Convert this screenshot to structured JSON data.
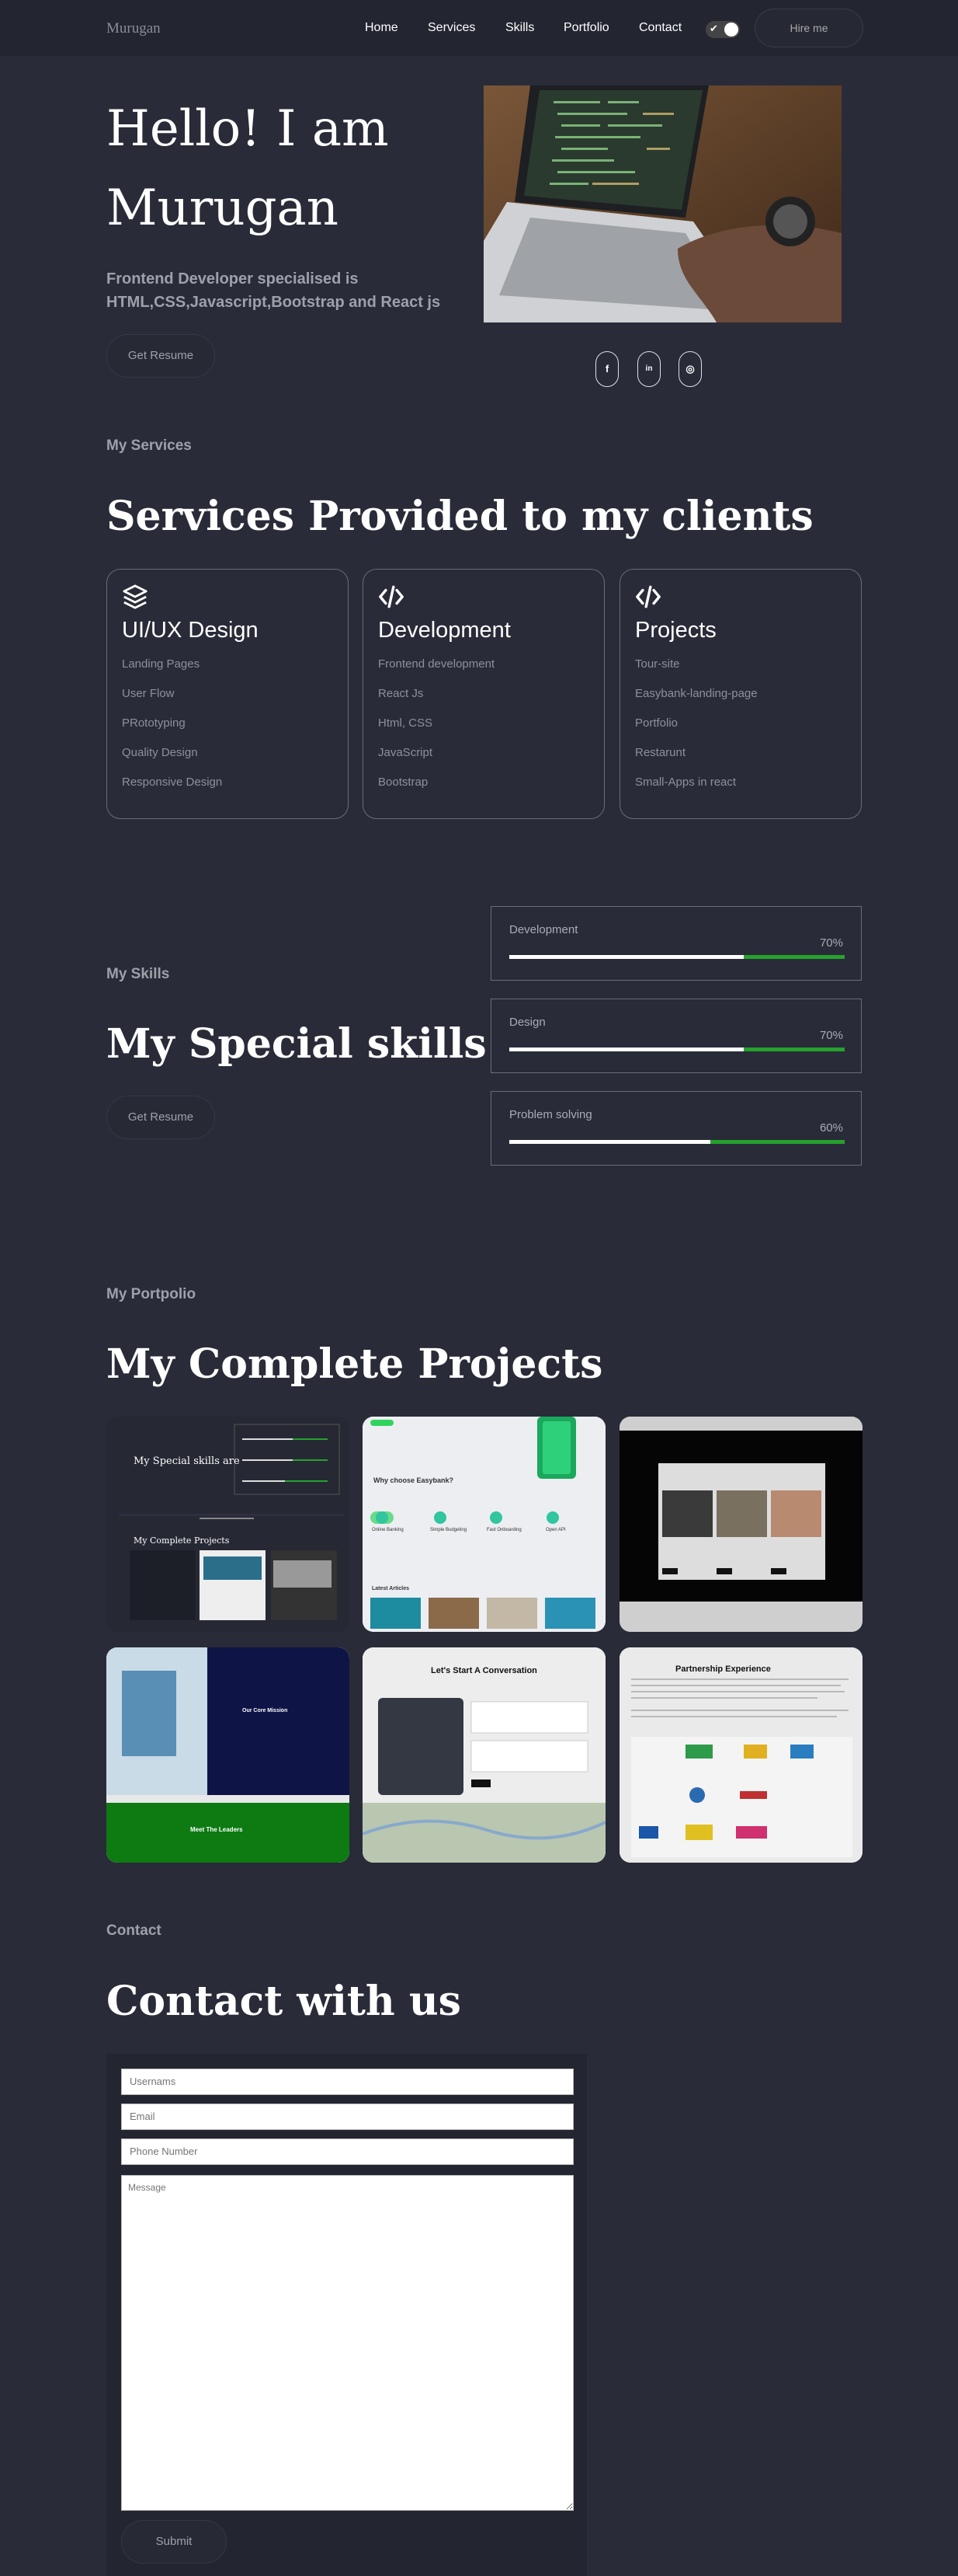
{
  "nav": {
    "logo": "Murugan",
    "links": [
      "Home",
      "Services",
      "Skills",
      "Portfolio",
      "Contact"
    ],
    "hire_label": "Hire me",
    "theme_toggle_check": "✔"
  },
  "hero": {
    "title": "Hello! I am Murugan",
    "subtitle": "Frontend Developer specialised is HTML,CSS,Javascript,Bootstrap and React js",
    "resume_label": "Get Resume",
    "socials": [
      {
        "icon": "facebook-icon",
        "glyph": "f"
      },
      {
        "icon": "linkedin-icon",
        "glyph": "in"
      },
      {
        "icon": "instagram-icon",
        "glyph": "◎"
      }
    ]
  },
  "services": {
    "label": "My Services",
    "heading": "Services Provided to my clients",
    "cards": [
      {
        "icon": "layers-icon",
        "title": "UI/UX Design",
        "items": [
          "Landing Pages",
          "User Flow",
          "PRototyping",
          "Quality Design",
          "Responsive Design"
        ]
      },
      {
        "icon": "code-icon",
        "title": "Development",
        "items": [
          "Frontend development",
          "React Js",
          "Html, CSS",
          "JavaScript",
          "Bootstrap"
        ]
      },
      {
        "icon": "code-icon",
        "title": "Projects",
        "items": [
          "Tour-site",
          "Easybank-landing-page",
          "Portfolio",
          "Restarunt",
          "Small-Apps in react"
        ]
      }
    ]
  },
  "skills": {
    "label": "My Skills",
    "heading": "My Special skills are",
    "resume_label": "Get Resume",
    "items": [
      {
        "name": "Development",
        "percent_label": "70%",
        "percent": 70
      },
      {
        "name": "Design",
        "percent_label": "70%",
        "percent": 70
      },
      {
        "name": "Problem solving",
        "percent_label": "60%",
        "percent": 60
      }
    ]
  },
  "portfolio": {
    "label": "My Portpolio",
    "heading": "My Complete Projects",
    "thumb_texts": {
      "p1_skills": "My Special skills are",
      "p1_projects": "My Complete Projects",
      "p2_title": "Why choose Easybank?",
      "p2_cols": [
        "Online Banking",
        "Simple Budgeting",
        "Fast Onboarding",
        "Open API"
      ],
      "p2_articles": "Latest Articles",
      "p4_mission": "Our Core Mission",
      "p4_leaders": "Meet The Leaders",
      "p5_title": "Let's Start A Conversation",
      "p6_title": "Partnership Experience"
    }
  },
  "contact": {
    "label": "Contact",
    "heading": "Contact with us",
    "username_placeholder": "Usernams",
    "email_placeholder": "Email",
    "phone_placeholder": "Phone Number",
    "message_placeholder": "Message",
    "submit_label": "Submit"
  },
  "colors": {
    "background": "#292b38",
    "nav": "#232530",
    "progress_green": "#25a22d"
  }
}
